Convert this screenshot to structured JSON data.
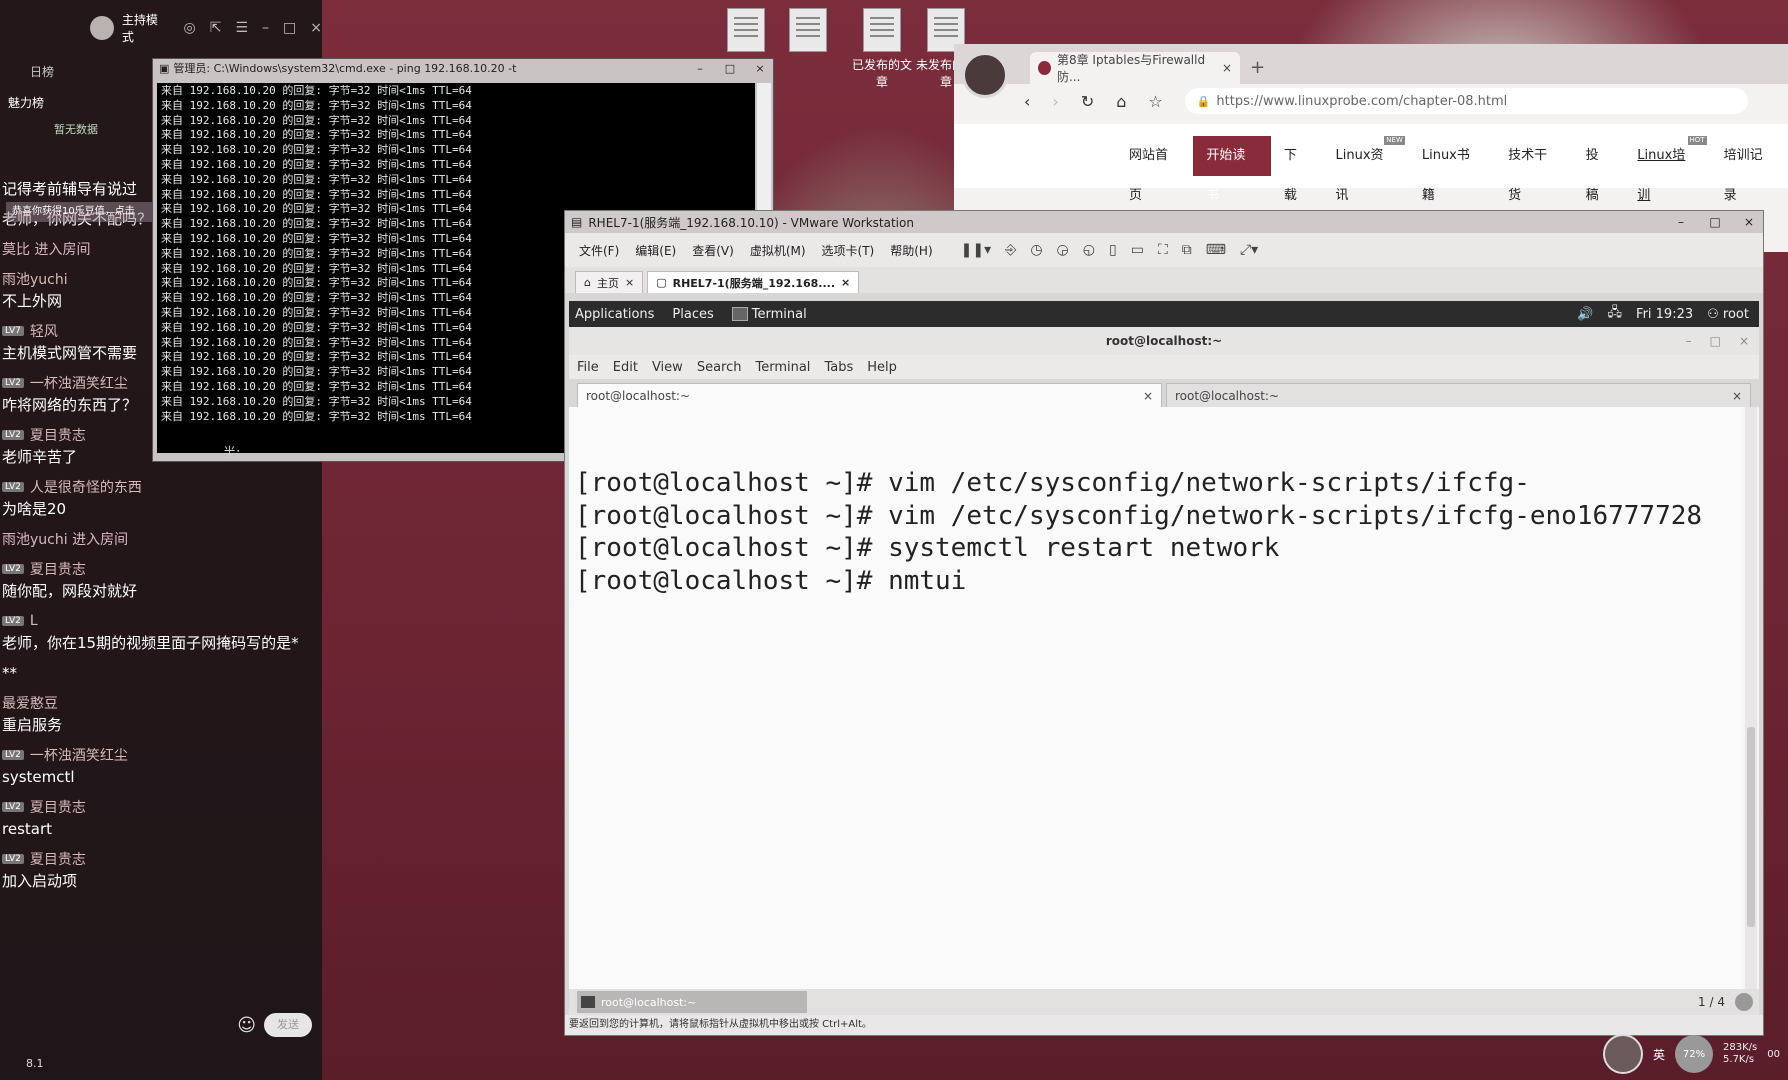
{
  "desktop": {
    "icons": [
      {
        "label": ""
      },
      {
        "label": ""
      },
      {
        "label": "已发布的文章"
      },
      {
        "label": "未发布的文章"
      }
    ]
  },
  "chat": {
    "mode_label": "主持模式",
    "tab_label": "日榜",
    "section_title": "魅力榜",
    "section_empty": "暂无数据",
    "notice_text": "恭喜你获得10乐豆值，点击",
    "messages": [
      {
        "who": "",
        "lv": "",
        "text": "记得考前辅导有说过"
      },
      {
        "who": "",
        "lv": "",
        "text": "老师，你网关不配吗？"
      },
      {
        "who": "莫比 进入房间",
        "lv": "",
        "text": ""
      },
      {
        "who": "雨池yuchi",
        "lv": "",
        "text": "不上外网"
      },
      {
        "who": "轻风",
        "lv": "LV7",
        "text": "主机模式网管不需要"
      },
      {
        "who": "一杯浊酒笑红尘",
        "lv": "LV2",
        "text": "咋将网络的东西了？"
      },
      {
        "who": "夏目贵志",
        "lv": "LV2",
        "text": "老师辛苦了"
      },
      {
        "who": "人是很奇怪的东西",
        "lv": "LV2",
        "text": "为啥是20"
      },
      {
        "who": "雨池yuchi 进入房间",
        "lv": "",
        "text": ""
      },
      {
        "who": "夏目贵志",
        "lv": "LV2",
        "text": "随你配，网段对就好"
      },
      {
        "who": "L",
        "lv": "LV2",
        "text": "老师，你在15期的视频里面子网掩码写的是*"
      },
      {
        "who": "",
        "lv": "",
        "text": "**"
      },
      {
        "who": "最爱憨豆",
        "lv": "",
        "text": "重启服务"
      },
      {
        "who": "一杯浊酒笑红尘",
        "lv": "LV2",
        "text": "systemctl"
      },
      {
        "who": "夏目贵志",
        "lv": "LV2",
        "text": "restart"
      },
      {
        "who": "夏目贵志",
        "lv": "LV2",
        "text": "加入启动项"
      }
    ],
    "send_label": "发送",
    "footer": "8.1"
  },
  "cmd": {
    "title": "管理员: C:\\Windows\\system32\\cmd.exe - ping 192.168.10.20 -t",
    "line": "来自 192.168.10.20 的回复: 字节=32 时间<1ms TTL=64",
    "line_count": 23,
    "ime": "半:"
  },
  "browser": {
    "tab_title": "第8章 Iptables与Firewalld防...",
    "url": "https://www.linuxprobe.com/chapter-08.html",
    "nav": [
      {
        "label": "网站首页",
        "tag": "",
        "active": false,
        "underline": false
      },
      {
        "label": "开始读书",
        "tag": "",
        "active": true,
        "underline": false
      },
      {
        "label": "下载",
        "tag": "",
        "active": false,
        "underline": false
      },
      {
        "label": "Linux资讯",
        "tag": "NEW",
        "active": false,
        "underline": false
      },
      {
        "label": "Linux书籍",
        "tag": "",
        "active": false,
        "underline": false
      },
      {
        "label": "技术干货",
        "tag": "",
        "active": false,
        "underline": false
      },
      {
        "label": "投稿",
        "tag": "",
        "active": false,
        "underline": false
      },
      {
        "label": "Linux培训",
        "tag": "HOT",
        "active": false,
        "underline": true
      },
      {
        "label": "培训记录",
        "tag": "",
        "active": false,
        "underline": false
      }
    ]
  },
  "vmware": {
    "title": "RHEL7-1(服务端_192.168.10.10) - VMware Workstation",
    "menu": [
      "文件(F)",
      "编辑(E)",
      "查看(V)",
      "虚拟机(M)",
      "选项卡(T)",
      "帮助(H)"
    ],
    "tabs": [
      {
        "label": "主页",
        "active": false
      },
      {
        "label": "RHEL7-1(服务端_192.168....",
        "active": true
      }
    ],
    "status_text": "要返回到您的计算机，请将鼠标指针从虚拟机中移出或按 Ctrl+Alt。"
  },
  "guest": {
    "bar": {
      "applications": "Applications",
      "places": "Places",
      "terminal": "Terminal",
      "clock": "Fri 19:23",
      "user": "root"
    },
    "terminal": {
      "title": "root@localhost:~",
      "menu": [
        "File",
        "Edit",
        "View",
        "Search",
        "Terminal",
        "Tabs",
        "Help"
      ],
      "tabs": [
        {
          "label": "root@localhost:~",
          "active": true
        },
        {
          "label": "root@localhost:~",
          "active": false
        }
      ],
      "lines": [
        "[root@localhost ~]# vim /etc/sysconfig/network-scripts/ifcfg-",
        "[root@localhost ~]# vim /etc/sysconfig/network-scripts/ifcfg-eno16777728",
        "[root@localhost ~]# systemctl restart network",
        "[root@localhost ~]# nmtui"
      ]
    },
    "taskbar": {
      "task": "root@localhost:~",
      "workspace": "1 / 4"
    }
  },
  "tray": {
    "lang": "英",
    "gauge": "72%",
    "up": "283K/s",
    "down": "5.7K/s",
    "extra": "00"
  }
}
